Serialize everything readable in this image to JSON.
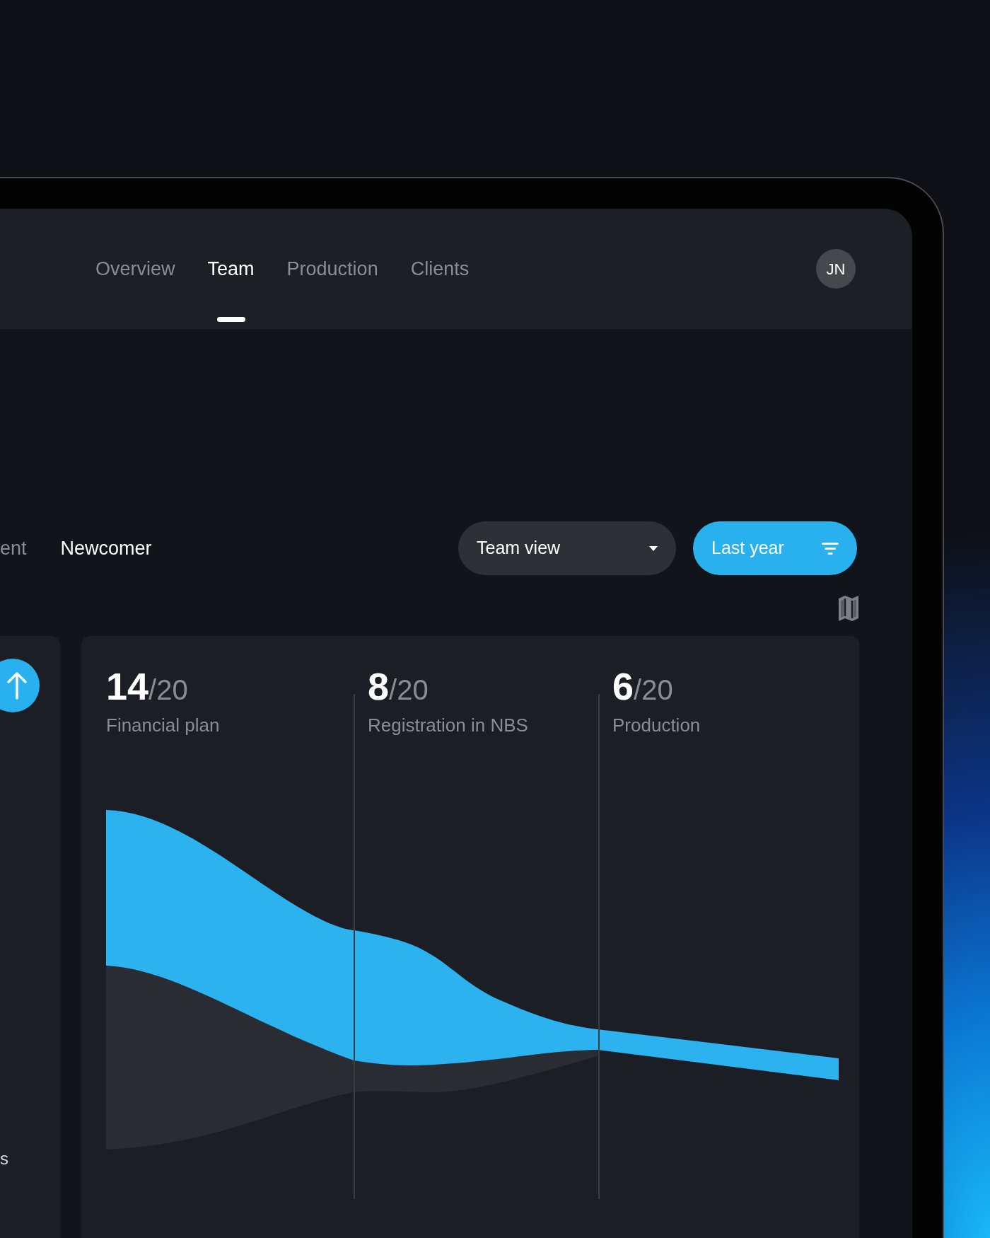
{
  "nav": {
    "tabs": [
      {
        "label": "Overview",
        "selected": false
      },
      {
        "label": "Team",
        "selected": true
      },
      {
        "label": "Production",
        "selected": false
      },
      {
        "label": "Clients",
        "selected": false
      }
    ],
    "avatar": {
      "initials": "JN"
    }
  },
  "subtabs": [
    {
      "label": "ent",
      "selected": false
    },
    {
      "label": "Newcomer",
      "selected": true
    }
  ],
  "view_select": {
    "value": "Team view"
  },
  "period_button": {
    "label": "Last year"
  },
  "side_card": {
    "text": "s"
  },
  "stats": [
    {
      "value": "14",
      "total": "/20",
      "label": "Financial plan"
    },
    {
      "value": "8",
      "total": "/20",
      "label": "Registration in NBS"
    },
    {
      "value": "6",
      "total": "/20",
      "label": "Production"
    }
  ]
}
